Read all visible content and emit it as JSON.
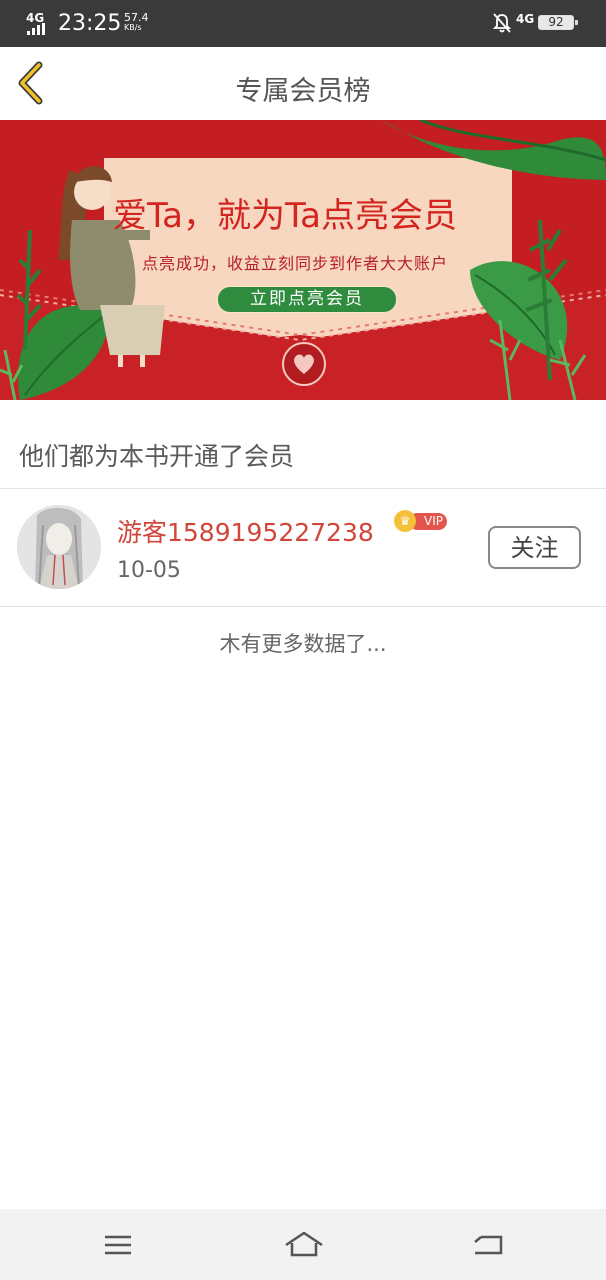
{
  "status_bar": {
    "network_left": "4G",
    "time": "23:25",
    "speed_value": "57.4",
    "speed_unit": "KB/s",
    "network_right": "4G",
    "battery": "92",
    "icons": [
      "signal-icon",
      "mute-bell-icon",
      "battery-icon"
    ]
  },
  "header": {
    "title": "专属会员榜",
    "back_icon": "chevron-left-icon",
    "accent_color": "#f0c02a"
  },
  "banner": {
    "headline": "爱Ta，就为Ta点亮会员",
    "subline": "点亮成功，收益立刻同步到作者大大账户",
    "button_label": "立即点亮会员",
    "colors": {
      "background": "#c41e22",
      "card": "#f7d7c0",
      "button": "#2f8c3f"
    }
  },
  "section": {
    "heading": "他们都为本书开通了会员"
  },
  "members": [
    {
      "name": "游客1589195227238",
      "badge": "VIP",
      "date": "10-05",
      "follow_label": "关注"
    }
  ],
  "list_footer": "木有更多数据了...",
  "nav_bar": {
    "icons": [
      "menu-icon",
      "home-icon",
      "back-icon"
    ]
  }
}
